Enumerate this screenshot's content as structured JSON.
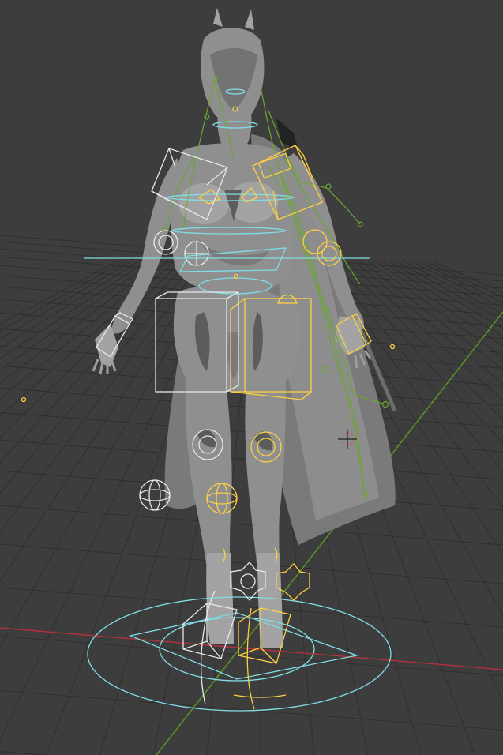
{
  "viewport": {
    "background": "#3d3d3d",
    "grid_color": "#2f2f2f",
    "axis_x_color": "#b5313b",
    "axis_y_color": "#5e9a26"
  },
  "model": {
    "color": "#8f8f8f",
    "shadow": "#6e6e6e"
  },
  "rig": {
    "control_white": "#e8e8e8",
    "control_yellow": "#ffd043",
    "control_cyan": "#7fdde6",
    "bone_green": "#6aa632"
  },
  "icons": {
    "cursor": "3d-cursor-icon"
  }
}
